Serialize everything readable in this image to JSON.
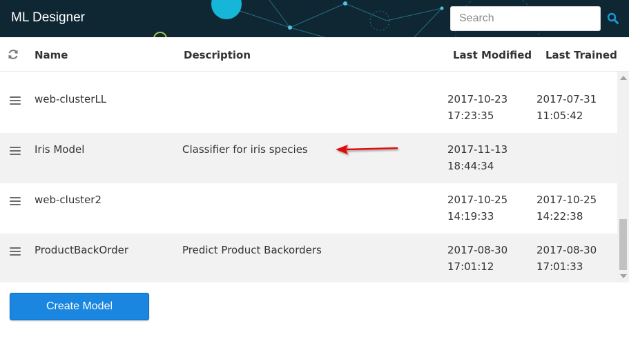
{
  "app": {
    "title": "ML Designer"
  },
  "search": {
    "placeholder": "Search"
  },
  "table": {
    "columns": {
      "name": "Name",
      "description": "Description",
      "last_modified": "Last Modified",
      "last_trained": "Last Trained"
    },
    "rows": [
      {
        "name": "web-clusterLL",
        "description": "",
        "modified_date": "2017-10-23",
        "modified_time": "17:23:35",
        "trained_date": "2017-07-31",
        "trained_time": "11:05:42"
      },
      {
        "name": "Iris Model",
        "description": "Classifier for iris species",
        "modified_date": "2017-11-13",
        "modified_time": "18:44:34",
        "trained_date": "",
        "trained_time": ""
      },
      {
        "name": "web-cluster2",
        "description": "",
        "modified_date": "2017-10-25",
        "modified_time": "14:19:33",
        "trained_date": "2017-10-25",
        "trained_time": "14:22:38"
      },
      {
        "name": "ProductBackOrder",
        "description": "Predict Product Backorders",
        "modified_date": "2017-08-30",
        "modified_time": "17:01:12",
        "trained_date": "2017-08-30",
        "trained_time": "17:01:33"
      }
    ]
  },
  "actions": {
    "create_model": "Create Model"
  },
  "icons": {
    "refresh": "refresh-icon",
    "search": "search-icon",
    "drag": "drag-handle-icon"
  },
  "colors": {
    "header_bg": "#0f2733",
    "accent": "#1a86e0",
    "annotation_arrow": "#e01010"
  }
}
